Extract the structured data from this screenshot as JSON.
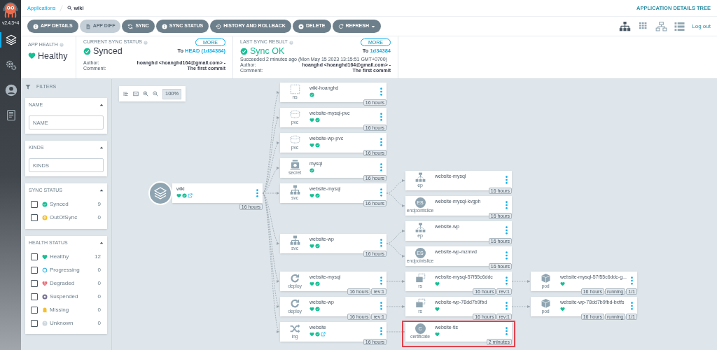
{
  "sidebar": {
    "version": "v2.4.3+4",
    "items": [
      {
        "kind": "applications",
        "selected": true
      },
      {
        "kind": "settings",
        "selected": false
      },
      {
        "kind": "user",
        "selected": false
      },
      {
        "kind": "docs",
        "selected": false
      }
    ]
  },
  "breadcrumb": [
    {
      "label": "Applications",
      "kind": "link"
    },
    {
      "label": "wiki",
      "kind": "search"
    }
  ],
  "page_title": "APPLICATION DETAILS TREE",
  "toolbar": {
    "buttons": [
      {
        "label": "APP DETAILS",
        "kind": "info",
        "disabled": false,
        "dropdown": false
      },
      {
        "label": "APP DIFF",
        "kind": "file",
        "disabled": true,
        "dropdown": false
      },
      {
        "label": "SYNC",
        "kind": "sync",
        "disabled": false,
        "dropdown": false
      },
      {
        "label": "SYNC STATUS",
        "kind": "info",
        "disabled": false,
        "dropdown": false
      },
      {
        "label": "HISTORY AND ROLLBACK",
        "kind": "history",
        "disabled": false,
        "dropdown": false
      },
      {
        "label": "DELETE",
        "kind": "delete",
        "disabled": false,
        "dropdown": false
      },
      {
        "label": "REFRESH",
        "kind": "refresh",
        "disabled": false,
        "dropdown": true
      }
    ],
    "view_modes": [
      {
        "kind": "tree",
        "selected": true
      },
      {
        "kind": "pods",
        "selected": false
      },
      {
        "kind": "network",
        "selected": false
      },
      {
        "kind": "list",
        "selected": false
      }
    ],
    "logout": "Log out"
  },
  "summary": {
    "app_health": {
      "label": "APP HEALTH",
      "value": "Healthy"
    },
    "current_sync": {
      "label": "CURRENT SYNC STATUS",
      "value": "Synced",
      "more": "MORE",
      "to": "To",
      "revision": "HEAD (1d34384)",
      "author_label": "Author:",
      "author": "hoanghd <hoanghd164@gmail.com> -",
      "comment_label": "Comment:",
      "comment": "The first commit"
    },
    "last_sync": {
      "label": "LAST SYNC RESULT",
      "value": "Sync OK",
      "more": "MORE",
      "to": "To",
      "revision": "1d34384",
      "detail": "Succeeded 2 minutes ago (Mon May 15 2023 13:15:51 GMT+0700)",
      "author_label": "Author:",
      "author": "hoanghd <hoanghd164@gmail.com> -",
      "comment_label": "Comment:",
      "comment": "The first commit"
    }
  },
  "filters": {
    "title": "FILTERS",
    "sections": [
      {
        "title": "NAME",
        "kind": "text",
        "placeholder": "NAME"
      },
      {
        "title": "KINDS",
        "kind": "text",
        "placeholder": "KINDS"
      },
      {
        "title": "SYNC STATUS",
        "kind": "checklist",
        "options": [
          {
            "label": "Synced",
            "count": "9",
            "kind": "synced",
            "checked": false
          },
          {
            "label": "OutOfSync",
            "count": "0",
            "kind": "outofsync",
            "checked": false
          }
        ]
      },
      {
        "title": "HEALTH STATUS",
        "kind": "checklist",
        "options": [
          {
            "label": "Healthy",
            "count": "12",
            "kind": "healthy",
            "checked": false
          },
          {
            "label": "Progressing",
            "count": "0",
            "kind": "progressing",
            "checked": false
          },
          {
            "label": "Degraded",
            "count": "0",
            "kind": "degraded",
            "checked": false
          },
          {
            "label": "Suspended",
            "count": "0",
            "kind": "suspended",
            "checked": false
          },
          {
            "label": "Missing",
            "count": "0",
            "kind": "missing",
            "checked": false
          },
          {
            "label": "Unknown",
            "count": "0",
            "kind": "unknown",
            "checked": false
          }
        ]
      }
    ]
  },
  "graph": {
    "zoom": "100%",
    "app": {
      "name": "wiki",
      "healthy": true,
      "synced": true,
      "link": true,
      "badges": [
        "16 hours"
      ],
      "children": [
        {
          "kind": "ns",
          "kind_label": "ns",
          "name": "wiki-hoanghd",
          "synced": true,
          "badges": [
            "16 hours"
          ],
          "highlighted": false
        },
        {
          "kind": "pvc",
          "kind_label": "pvc",
          "name": "website-mysql-pvc",
          "healthy": true,
          "synced": true,
          "badges": [
            "16 hours"
          ],
          "highlighted": false
        },
        {
          "kind": "pvc",
          "kind_label": "pvc",
          "name": "website-wp-pvc",
          "healthy": true,
          "synced": true,
          "badges": [
            "16 hours"
          ],
          "highlighted": false
        },
        {
          "kind": "secret",
          "kind_label": "secret",
          "name": "mysql",
          "synced": true,
          "badges": [
            "16 hours"
          ],
          "highlighted": false
        },
        {
          "kind": "svc",
          "kind_label": "svc",
          "name": "website-mysql",
          "healthy": true,
          "synced": true,
          "badges": [
            "16 hours"
          ],
          "highlighted": false,
          "children": [
            {
              "kind": "ep",
              "kind_label": "ep",
              "name": "website-mysql",
              "badges": [
                "16 hours"
              ],
              "highlighted": false
            },
            {
              "kind": "endpointslice",
              "kind_label": "endpointslice",
              "icon_text": "ES",
              "name": "website-mysql-kvgph",
              "badges": [
                "16 hours"
              ],
              "highlighted": false
            }
          ]
        },
        {
          "kind": "svc",
          "kind_label": "svc",
          "name": "website-wp",
          "healthy": true,
          "synced": true,
          "badges": [
            "16 hours"
          ],
          "highlighted": false,
          "children": [
            {
              "kind": "ep",
              "kind_label": "ep",
              "name": "website-wp",
              "badges": [
                "16 hours"
              ],
              "highlighted": false
            },
            {
              "kind": "endpointslice",
              "kind_label": "endpointslice",
              "icon_text": "ES",
              "name": "website-wp-mzmvd",
              "badges": [
                "16 hours"
              ],
              "highlighted": false
            }
          ]
        },
        {
          "kind": "deploy",
          "kind_label": "deploy",
          "name": "website-mysql",
          "healthy": true,
          "synced": true,
          "badges": [
            "16 hours",
            "rev:1"
          ],
          "highlighted": false,
          "children": [
            {
              "kind": "rs",
              "kind_label": "rs",
              "name": "website-mysql-57f55c6ddc",
              "healthy": true,
              "badges": [
                "16 hours",
                "rev:1"
              ],
              "highlighted": false,
              "children": [
                {
                  "kind": "pod",
                  "kind_label": "pod",
                  "name": "website-mysql-57f55c6ddc-g...",
                  "healthy": true,
                  "badges": [
                    "16 hours",
                    "running",
                    "1/1"
                  ],
                  "highlighted": false
                }
              ]
            }
          ]
        },
        {
          "kind": "deploy",
          "kind_label": "deploy",
          "name": "website-wp",
          "healthy": true,
          "synced": true,
          "badges": [
            "16 hours",
            "rev:1"
          ],
          "highlighted": false,
          "children": [
            {
              "kind": "rs",
              "kind_label": "rs",
              "name": "website-wp-78dd7b9fbd",
              "healthy": true,
              "badges": [
                "16 hours",
                "rev:1"
              ],
              "highlighted": false,
              "children": [
                {
                  "kind": "pod",
                  "kind_label": "pod",
                  "name": "website-wp-78dd7b9fbd-bxtfs",
                  "healthy": true,
                  "badges": [
                    "16 hours",
                    "running",
                    "1/1"
                  ],
                  "highlighted": false
                }
              ]
            }
          ]
        },
        {
          "kind": "ing",
          "kind_label": "ing",
          "name": "website",
          "healthy": true,
          "synced": true,
          "link": true,
          "badges": [
            "16 hours"
          ],
          "highlighted": false,
          "children": [
            {
              "kind": "certificate",
              "kind_label": "certificate",
              "icon_text": "C",
              "name": "website-tls",
              "healthy": true,
              "badges": [
                "2 minutes"
              ],
              "highlighted": true
            }
          ]
        }
      ]
    }
  }
}
